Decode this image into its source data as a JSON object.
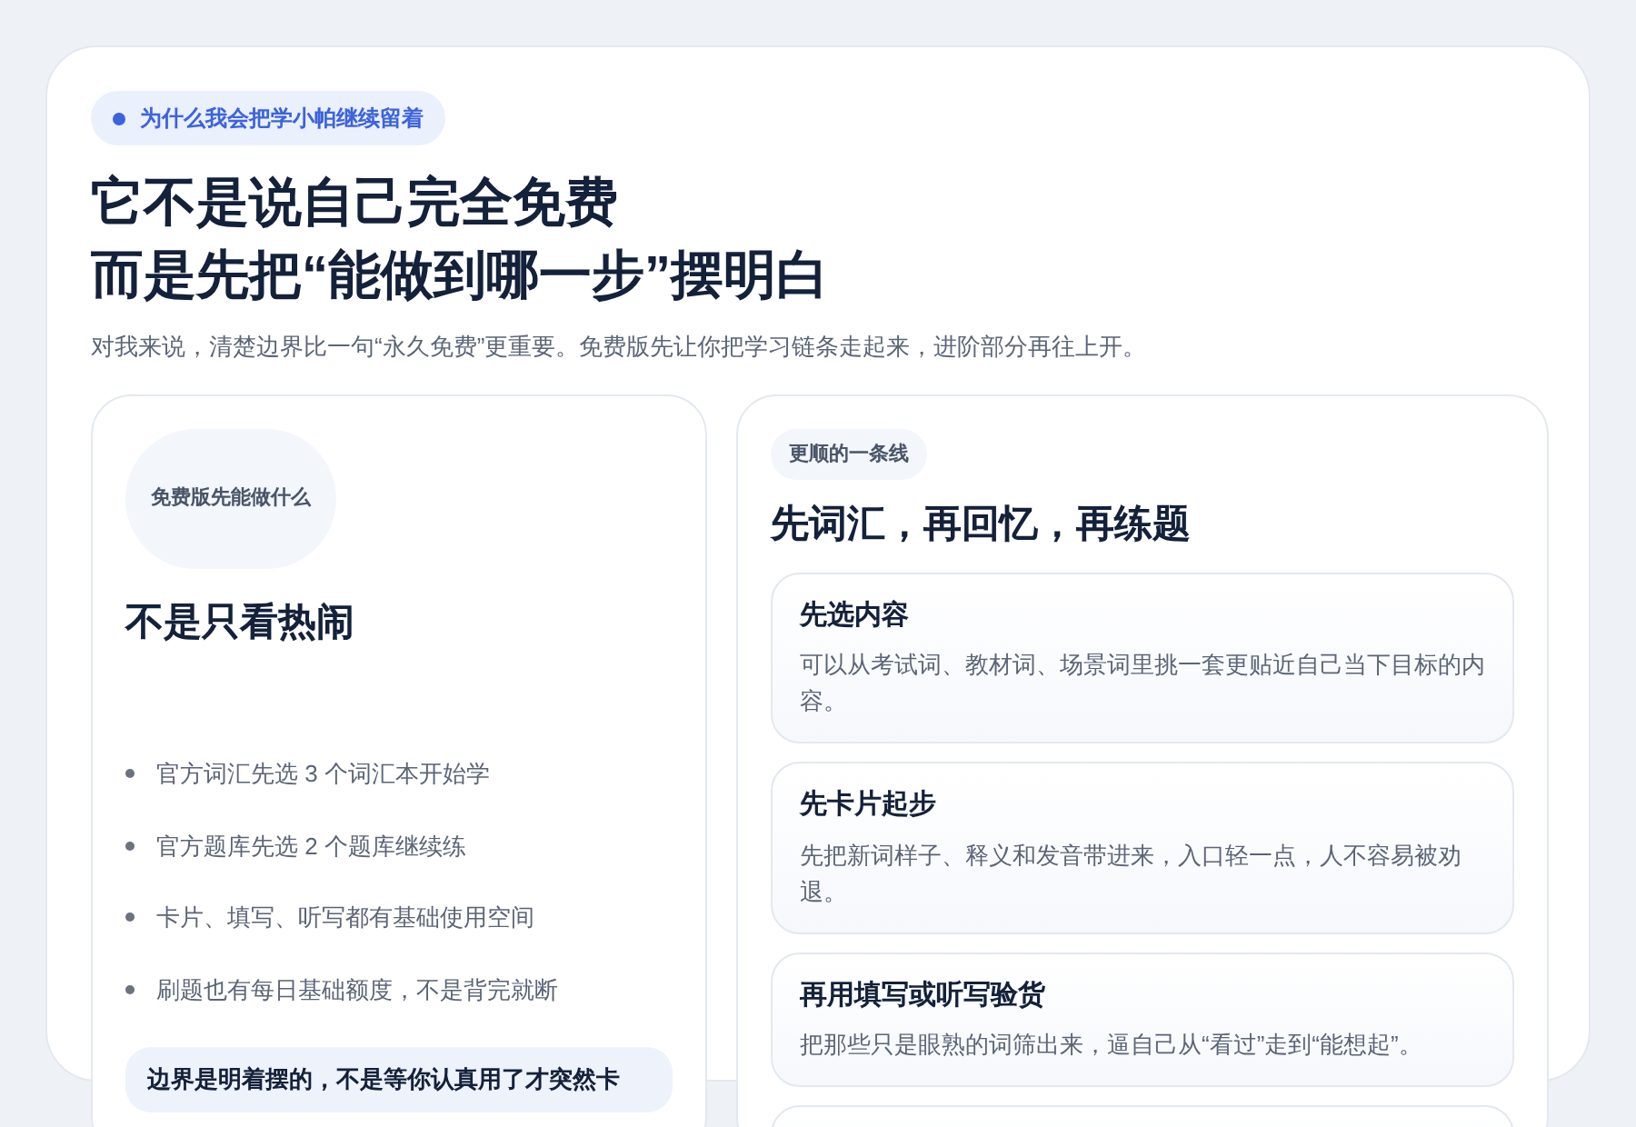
{
  "badge": "为什么我会把学小帕继续留着",
  "title_lines": [
    "它不是说自己完全免费",
    "而是先把“能做到哪一步”摆明白"
  ],
  "subtitle": "对我来说，清楚边界比一句“永久免费”更重要。免费版先让你把学习链条走起来，进阶部分再往上开。",
  "left_card": {
    "tag": "免费版先能做什么",
    "heading": "不是只看热闹",
    "bullets": [
      "官方词汇先选 3 个词汇本开始学",
      "官方题库先选 2 个题库继续练",
      "卡片、填写、听写都有基础使用空间",
      "刷题也有每日基础额度，不是背完就断"
    ],
    "callout": "边界是明着摆的，不是等你认真用了才突然卡"
  },
  "right_card": {
    "tag": "更顺的一条线",
    "heading": "先词汇，再回忆，再练题",
    "steps": [
      {
        "title": "先选内容",
        "text": "可以从考试词、教材词、场景词里挑一套更贴近自己当下目标的内容。"
      },
      {
        "title": "先卡片起步",
        "text": "先把新词样子、释义和发音带进来，入口轻一点，人不容易被劝退。"
      },
      {
        "title": "再用填写或听写验货",
        "text": "把那些只是眼熟的词筛出来，逼自己从“看过”走到“能想起”。"
      }
    ]
  }
}
